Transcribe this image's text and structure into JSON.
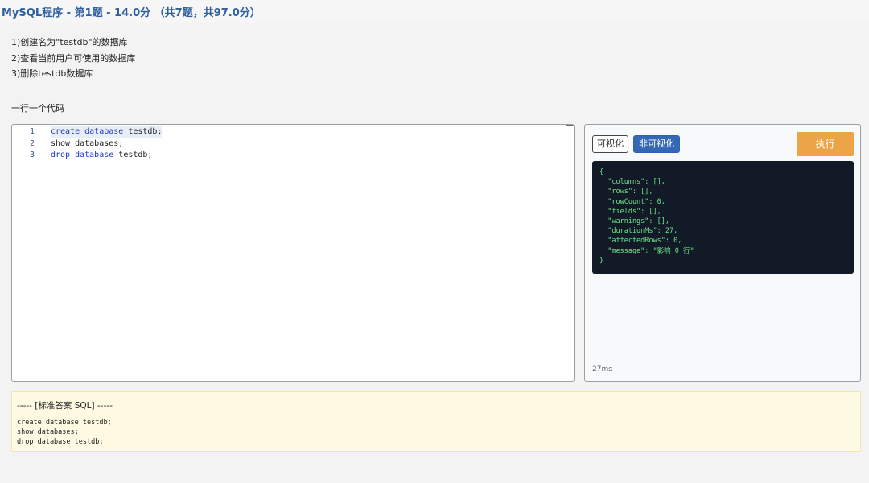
{
  "header": {
    "title": "MySQL程序 - 第1题 - 14.0分 （共7题，共97.0分）"
  },
  "question": {
    "steps": [
      "1)创建名为\"testdb\"的数据库",
      "2)查看当前用户可使用的数据库",
      "3)删除testdb数据库"
    ],
    "hint": "一行一个代码"
  },
  "editor": {
    "lines": [
      {
        "number": "1",
        "keyword": "create database",
        "rest": " testdb;"
      },
      {
        "number": "2",
        "keyword": "",
        "rest": "show databases;"
      },
      {
        "number": "3",
        "keyword": "drop database",
        "rest": " testdb;"
      }
    ]
  },
  "result_panel": {
    "visual_label": "可视化",
    "nonvisual_label": "非可视化",
    "execute_label": "执行",
    "json_lines": [
      "{",
      "  \"columns\": [],",
      "  \"rows\": [],",
      "  \"rowCount\": 0,",
      "  \"fields\": [],",
      "  \"warnings\": [],",
      "  \"durationMs\": 27,",
      "  \"affectedRows\": 0,",
      "  \"message\": \"影响 0 行\"",
      "}"
    ],
    "duration": "27ms"
  },
  "answer": {
    "title": "----- [标准答案 SQL] -----",
    "code": "create database testdb;\nshow databases;\ndrop database testdb;"
  },
  "colors": {
    "accent": "#2f5f9c",
    "execute_button": "#eca446",
    "nonvisual_button": "#3468b5",
    "json_bg": "#111a26",
    "json_text": "#6fe089",
    "answer_bg": "#fdf9e2"
  }
}
